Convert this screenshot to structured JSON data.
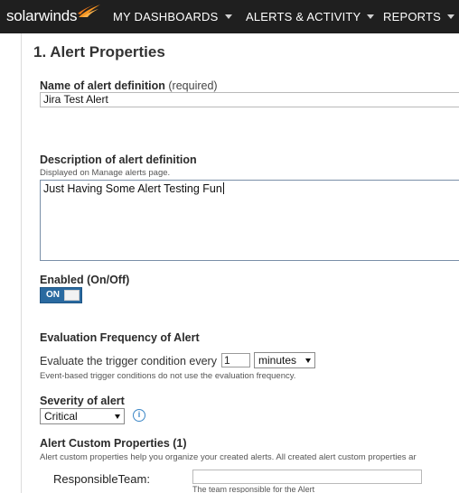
{
  "header": {
    "logo_text": "solarwinds",
    "nav": [
      {
        "label": "MY DASHBOARDS"
      },
      {
        "label": "ALERTS & ACTIVITY"
      },
      {
        "label": "REPORTS"
      }
    ],
    "background": "#1f1f1f",
    "logo_accent": "#f79420"
  },
  "form": {
    "section_title": "1. Alert Properties",
    "name": {
      "label": "Name of alert definition",
      "required": "(required)",
      "value": "Jira Test Alert"
    },
    "description": {
      "label": "Description of alert definition",
      "hint": "Displayed on Manage alerts page.",
      "value": "Just Having Some Alert Testing Fun"
    },
    "enabled": {
      "label": "Enabled (On/Off)",
      "state": "ON",
      "color": "#2a6aa0"
    },
    "evaluation": {
      "label": "Evaluation Frequency of Alert",
      "text": "Evaluate the trigger condition every",
      "value": "1",
      "unit": "minutes",
      "hint": "Event-based trigger conditions do not use the evaluation frequency."
    },
    "severity": {
      "label": "Severity of alert",
      "value": "Critical",
      "info_icon": "info-icon"
    },
    "custom_properties": {
      "label": "Alert Custom Properties (1)",
      "hint": "Alert custom properties help you organize your created alerts. All created alert custom properties ar",
      "items": [
        {
          "name": "ResponsibleTeam:",
          "value": "",
          "hint": "The team responsible for the Alert"
        }
      ]
    }
  }
}
